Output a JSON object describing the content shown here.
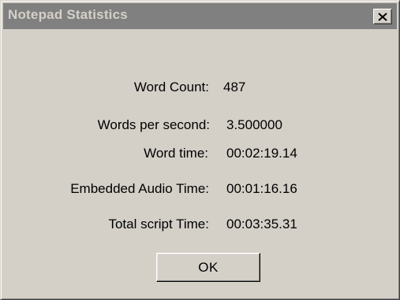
{
  "dialog": {
    "title": "Notepad Statistics",
    "close_symbol": "×"
  },
  "stats": [
    {
      "label": "Word Count:",
      "value": "487"
    },
    {
      "label": "Words per second:",
      "value": "3.500000"
    },
    {
      "label": "Word time:",
      "value": "00:02:19.14"
    },
    {
      "label": "Embedded Audio Time:",
      "value": "00:01:16.16"
    },
    {
      "label": "Total script Time:",
      "value": "00:03:35.31"
    }
  ],
  "buttons": {
    "ok_label": "OK"
  },
  "colors": {
    "face": "#d4d0c8",
    "titlebar_inactive": "#808080",
    "title_text": "#d4d0c8"
  },
  "icons": {
    "close": "close-icon"
  }
}
